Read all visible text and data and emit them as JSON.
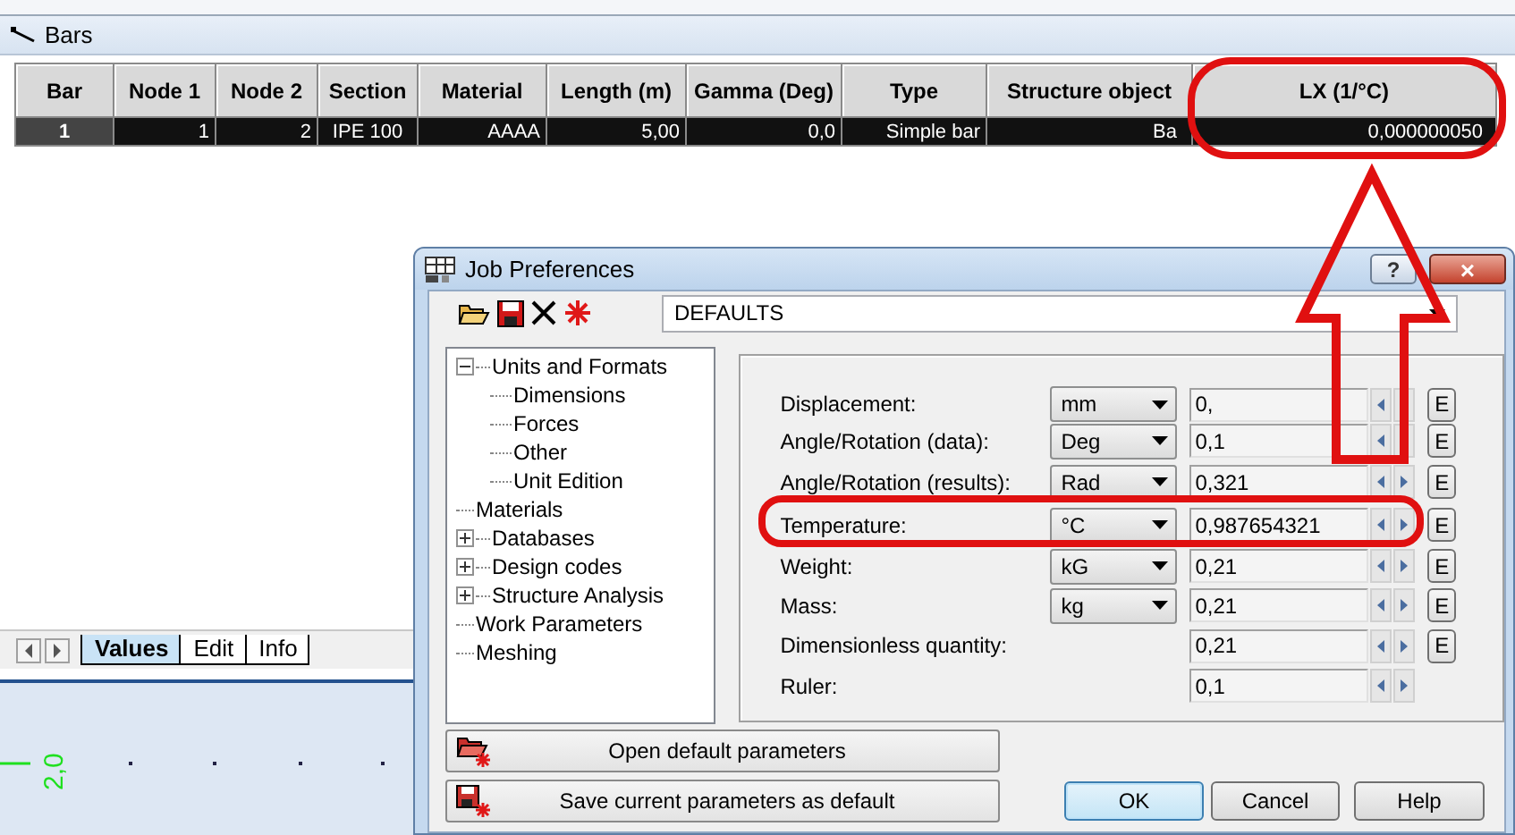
{
  "bars_window": {
    "title": "Bars",
    "table": {
      "columns": [
        "Bar",
        "Node 1",
        "Node 2",
        "Section",
        "Material",
        "Length (m)",
        "Gamma (Deg)",
        "Type",
        "Structure object",
        "LX (1/°C)"
      ],
      "rows": [
        {
          "cells": [
            "1",
            "1",
            "2",
            "IPE 100",
            "AAAA",
            "5,00",
            "0,0",
            "Simple bar",
            "Ba",
            "0,000000050"
          ],
          "selected": true
        }
      ]
    },
    "tabs": [
      {
        "label": "Values",
        "selected": true
      },
      {
        "label": "Edit",
        "selected": false
      },
      {
        "label": "Info",
        "selected": false
      }
    ]
  },
  "canvas": {
    "axis_label": "2,0"
  },
  "dialog": {
    "title": "Job Preferences",
    "title_buttons": [
      {
        "label": "?",
        "kind": "help"
      },
      {
        "label": "×",
        "kind": "close"
      }
    ],
    "preset": "DEFAULTS",
    "tree": [
      {
        "label": "Units and Formats",
        "expanded": true,
        "children": [
          {
            "label": "Dimensions"
          },
          {
            "label": "Forces"
          },
          {
            "label": "Other"
          },
          {
            "label": "Unit Edition"
          }
        ]
      },
      {
        "label": "Materials"
      },
      {
        "label": "Databases",
        "expanded": false
      },
      {
        "label": "Design codes",
        "expanded": false
      },
      {
        "label": "Structure Analysis",
        "expanded": false
      },
      {
        "label": "Work Parameters"
      },
      {
        "label": "Meshing"
      }
    ],
    "rows": [
      {
        "label": "Displacement:",
        "unit": "mm",
        "value": "0,",
        "edit": "E"
      },
      {
        "label": "Angle/Rotation (data):",
        "unit": "Deg",
        "value": "0,1",
        "edit": "E"
      },
      {
        "label": "Angle/Rotation (results):",
        "unit": "Rad",
        "value": "0,321",
        "edit": "E"
      },
      {
        "label": "Temperature:",
        "unit": "°C",
        "value": "0,987654321",
        "edit": "E"
      },
      {
        "label": "Weight:",
        "unit": "kG",
        "value": "0,21",
        "edit": "E"
      },
      {
        "label": "Mass:",
        "unit": "kg",
        "value": "0,21",
        "edit": "E"
      },
      {
        "label": "Dimensionless quantity:",
        "value": "0,21",
        "edit": "E"
      },
      {
        "label": "Ruler:",
        "value": "0,1"
      }
    ],
    "side_buttons": [
      {
        "label": "Open default parameters",
        "kind": "open"
      },
      {
        "label": "Save current parameters as default",
        "kind": "save"
      }
    ],
    "buttons": [
      {
        "label": "OK",
        "default": true
      },
      {
        "label": "Cancel",
        "default": false
      },
      {
        "label": "Help",
        "default": false
      }
    ]
  }
}
